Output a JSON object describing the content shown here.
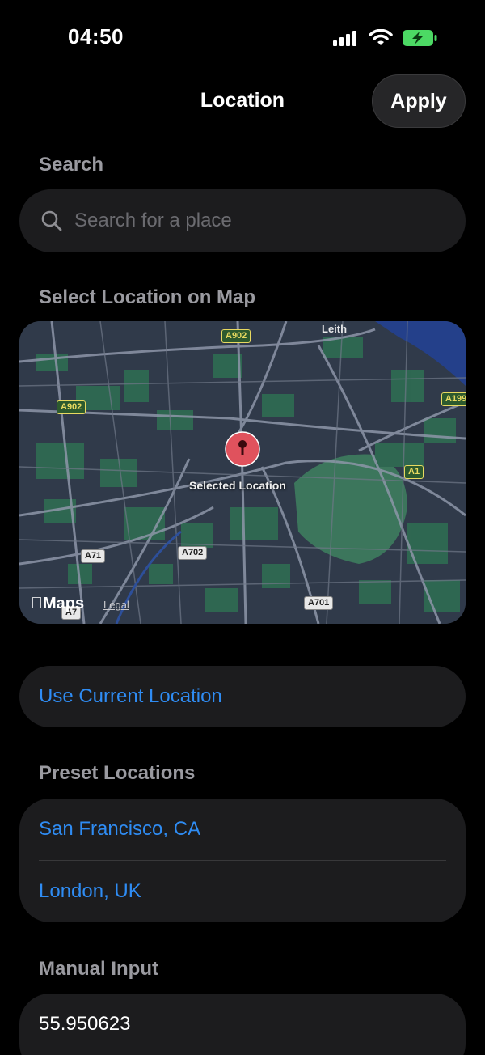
{
  "status_bar": {
    "time": "04:50"
  },
  "nav": {
    "title": "Location",
    "apply_label": "Apply"
  },
  "search": {
    "section_label": "Search",
    "placeholder": "Search for a place",
    "icon": "magnifying-glass"
  },
  "map": {
    "section_label": "Select Location on Map",
    "pin_label": "Selected Location",
    "place_label": "Leith",
    "road_labels": [
      "A902",
      "A902",
      "A199",
      "A1",
      "A71",
      "A702",
      "A701",
      "A7"
    ],
    "maps_brand": "Maps",
    "legal": "Legal"
  },
  "current_location": {
    "label": "Use Current Location"
  },
  "presets": {
    "section_label": "Preset Locations",
    "items": [
      "San Francisco, CA",
      "London, UK"
    ]
  },
  "manual": {
    "section_label": "Manual Input",
    "latitude": "55.950623"
  },
  "colors": {
    "accent": "#2f8cf3",
    "battery": "#4cd964",
    "pin": "#e0525d"
  }
}
